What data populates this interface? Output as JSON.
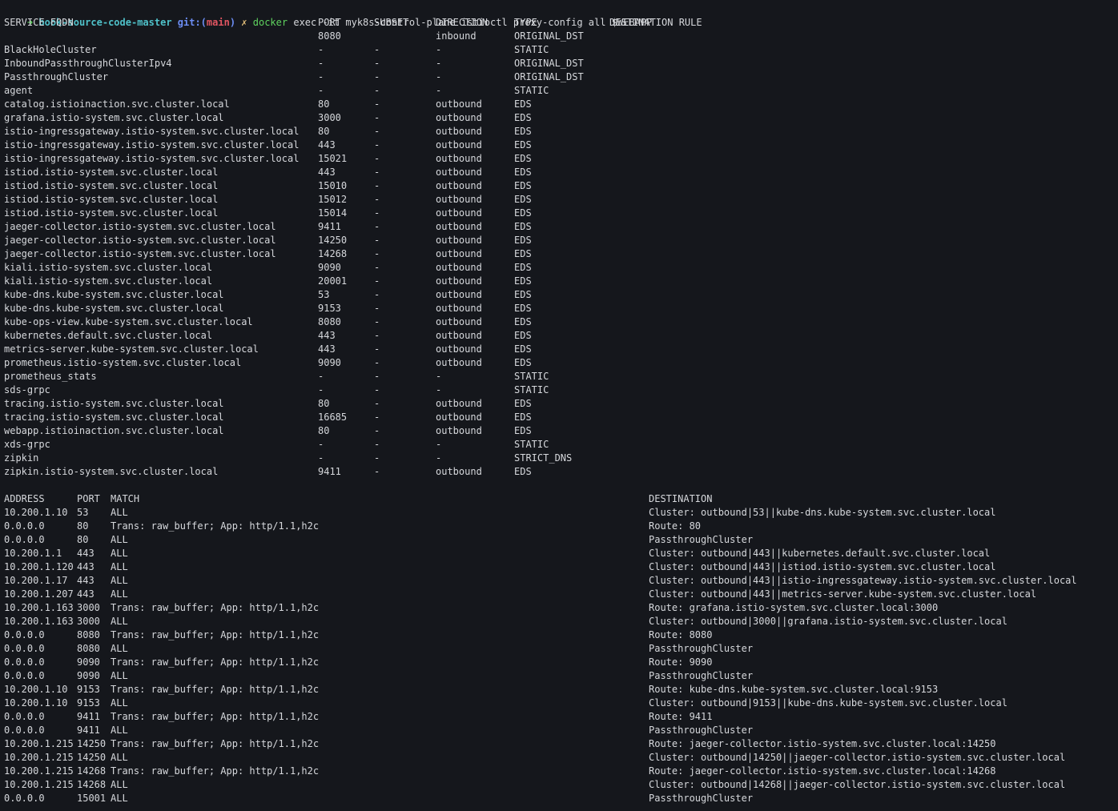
{
  "prompt": {
    "arrow": "➜",
    "directory": "book-source-code-master",
    "git_label": "git:(",
    "branch": "main",
    "git_close": ")",
    "dirty_marker": "✗",
    "command": "docker",
    "args": "exec -it myk8s-control-plane istioctl proxy-config all $WEBAPP"
  },
  "clusters": {
    "headers": [
      "SERVICE FQDN",
      "PORT",
      "SUBSET",
      "DIRECTION",
      "TYPE",
      "DESTINATION RULE"
    ],
    "rows": [
      [
        "",
        "8080",
        "",
        "inbound",
        "ORIGINAL_DST",
        ""
      ],
      [
        "BlackHoleCluster",
        "-",
        "-",
        "-",
        "STATIC",
        ""
      ],
      [
        "InboundPassthroughClusterIpv4",
        "-",
        "-",
        "-",
        "ORIGINAL_DST",
        ""
      ],
      [
        "PassthroughCluster",
        "-",
        "-",
        "-",
        "ORIGINAL_DST",
        ""
      ],
      [
        "agent",
        "-",
        "-",
        "-",
        "STATIC",
        ""
      ],
      [
        "catalog.istioinaction.svc.cluster.local",
        "80",
        "-",
        "outbound",
        "EDS",
        ""
      ],
      [
        "grafana.istio-system.svc.cluster.local",
        "3000",
        "-",
        "outbound",
        "EDS",
        ""
      ],
      [
        "istio-ingressgateway.istio-system.svc.cluster.local",
        "80",
        "-",
        "outbound",
        "EDS",
        ""
      ],
      [
        "istio-ingressgateway.istio-system.svc.cluster.local",
        "443",
        "-",
        "outbound",
        "EDS",
        ""
      ],
      [
        "istio-ingressgateway.istio-system.svc.cluster.local",
        "15021",
        "-",
        "outbound",
        "EDS",
        ""
      ],
      [
        "istiod.istio-system.svc.cluster.local",
        "443",
        "-",
        "outbound",
        "EDS",
        ""
      ],
      [
        "istiod.istio-system.svc.cluster.local",
        "15010",
        "-",
        "outbound",
        "EDS",
        ""
      ],
      [
        "istiod.istio-system.svc.cluster.local",
        "15012",
        "-",
        "outbound",
        "EDS",
        ""
      ],
      [
        "istiod.istio-system.svc.cluster.local",
        "15014",
        "-",
        "outbound",
        "EDS",
        ""
      ],
      [
        "jaeger-collector.istio-system.svc.cluster.local",
        "9411",
        "-",
        "outbound",
        "EDS",
        ""
      ],
      [
        "jaeger-collector.istio-system.svc.cluster.local",
        "14250",
        "-",
        "outbound",
        "EDS",
        ""
      ],
      [
        "jaeger-collector.istio-system.svc.cluster.local",
        "14268",
        "-",
        "outbound",
        "EDS",
        ""
      ],
      [
        "kiali.istio-system.svc.cluster.local",
        "9090",
        "-",
        "outbound",
        "EDS",
        ""
      ],
      [
        "kiali.istio-system.svc.cluster.local",
        "20001",
        "-",
        "outbound",
        "EDS",
        ""
      ],
      [
        "kube-dns.kube-system.svc.cluster.local",
        "53",
        "-",
        "outbound",
        "EDS",
        ""
      ],
      [
        "kube-dns.kube-system.svc.cluster.local",
        "9153",
        "-",
        "outbound",
        "EDS",
        ""
      ],
      [
        "kube-ops-view.kube-system.svc.cluster.local",
        "8080",
        "-",
        "outbound",
        "EDS",
        ""
      ],
      [
        "kubernetes.default.svc.cluster.local",
        "443",
        "-",
        "outbound",
        "EDS",
        ""
      ],
      [
        "metrics-server.kube-system.svc.cluster.local",
        "443",
        "-",
        "outbound",
        "EDS",
        ""
      ],
      [
        "prometheus.istio-system.svc.cluster.local",
        "9090",
        "-",
        "outbound",
        "EDS",
        ""
      ],
      [
        "prometheus_stats",
        "-",
        "-",
        "-",
        "STATIC",
        ""
      ],
      [
        "sds-grpc",
        "-",
        "-",
        "-",
        "STATIC",
        ""
      ],
      [
        "tracing.istio-system.svc.cluster.local",
        "80",
        "-",
        "outbound",
        "EDS",
        ""
      ],
      [
        "tracing.istio-system.svc.cluster.local",
        "16685",
        "-",
        "outbound",
        "EDS",
        ""
      ],
      [
        "webapp.istioinaction.svc.cluster.local",
        "80",
        "-",
        "outbound",
        "EDS",
        ""
      ],
      [
        "xds-grpc",
        "-",
        "-",
        "-",
        "STATIC",
        ""
      ],
      [
        "zipkin",
        "-",
        "-",
        "-",
        "STRICT_DNS",
        ""
      ],
      [
        "zipkin.istio-system.svc.cluster.local",
        "9411",
        "-",
        "outbound",
        "EDS",
        ""
      ]
    ]
  },
  "listeners": {
    "headers": [
      "ADDRESS",
      "PORT",
      "MATCH",
      "DESTINATION"
    ],
    "rows": [
      [
        "10.200.1.10",
        "53",
        "ALL",
        "Cluster: outbound|53||kube-dns.kube-system.svc.cluster.local"
      ],
      [
        "0.0.0.0",
        "80",
        "Trans: raw_buffer; App: http/1.1,h2c",
        "Route: 80"
      ],
      [
        "0.0.0.0",
        "80",
        "ALL",
        "PassthroughCluster"
      ],
      [
        "10.200.1.1",
        "443",
        "ALL",
        "Cluster: outbound|443||kubernetes.default.svc.cluster.local"
      ],
      [
        "10.200.1.120",
        "443",
        "ALL",
        "Cluster: outbound|443||istiod.istio-system.svc.cluster.local"
      ],
      [
        "10.200.1.17",
        "443",
        "ALL",
        "Cluster: outbound|443||istio-ingressgateway.istio-system.svc.cluster.local"
      ],
      [
        "10.200.1.207",
        "443",
        "ALL",
        "Cluster: outbound|443||metrics-server.kube-system.svc.cluster.local"
      ],
      [
        "10.200.1.163",
        "3000",
        "Trans: raw_buffer; App: http/1.1,h2c",
        "Route: grafana.istio-system.svc.cluster.local:3000"
      ],
      [
        "10.200.1.163",
        "3000",
        "ALL",
        "Cluster: outbound|3000||grafana.istio-system.svc.cluster.local"
      ],
      [
        "0.0.0.0",
        "8080",
        "Trans: raw_buffer; App: http/1.1,h2c",
        "Route: 8080"
      ],
      [
        "0.0.0.0",
        "8080",
        "ALL",
        "PassthroughCluster"
      ],
      [
        "0.0.0.0",
        "9090",
        "Trans: raw_buffer; App: http/1.1,h2c",
        "Route: 9090"
      ],
      [
        "0.0.0.0",
        "9090",
        "ALL",
        "PassthroughCluster"
      ],
      [
        "10.200.1.10",
        "9153",
        "Trans: raw_buffer; App: http/1.1,h2c",
        "Route: kube-dns.kube-system.svc.cluster.local:9153"
      ],
      [
        "10.200.1.10",
        "9153",
        "ALL",
        "Cluster: outbound|9153||kube-dns.kube-system.svc.cluster.local"
      ],
      [
        "0.0.0.0",
        "9411",
        "Trans: raw_buffer; App: http/1.1,h2c",
        "Route: 9411"
      ],
      [
        "0.0.0.0",
        "9411",
        "ALL",
        "PassthroughCluster"
      ],
      [
        "10.200.1.215",
        "14250",
        "Trans: raw_buffer; App: http/1.1,h2c",
        "Route: jaeger-collector.istio-system.svc.cluster.local:14250"
      ],
      [
        "10.200.1.215",
        "14250",
        "ALL",
        "Cluster: outbound|14250||jaeger-collector.istio-system.svc.cluster.local"
      ],
      [
        "10.200.1.215",
        "14268",
        "Trans: raw_buffer; App: http/1.1,h2c",
        "Route: jaeger-collector.istio-system.svc.cluster.local:14268"
      ],
      [
        "10.200.1.215",
        "14268",
        "ALL",
        "Cluster: outbound|14268||jaeger-collector.istio-system.svc.cluster.local"
      ],
      [
        "0.0.0.0",
        "15001",
        "ALL",
        "PassthroughCluster"
      ]
    ]
  }
}
